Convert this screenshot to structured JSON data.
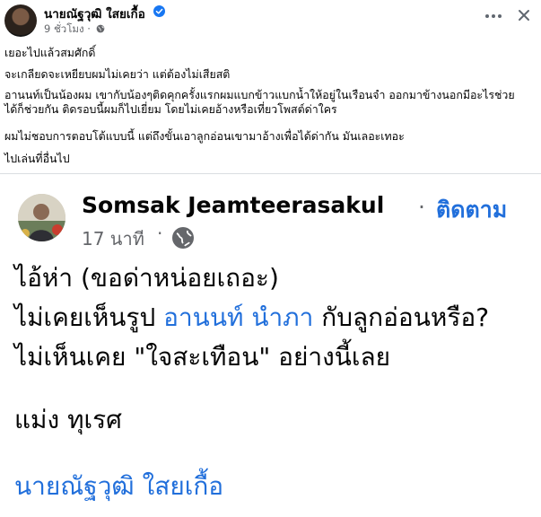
{
  "post": {
    "author": "นายณัฐวุฒิ ใสยเกื้อ",
    "time": "9 ชั่วโมง",
    "meta_sep": "·",
    "paragraphs": [
      "เยอะไปแล้วสมศักดิ์",
      "จะเกลียดจะเหยียบผมไม่เคยว่า แต่ต้องไม่เสียสติ",
      "อานนท์เป็นน้องผม เขากับน้องๆติดคุกครั้งแรกผมแบกข้าวแบกน้ำให้อยู่ในเรือนจำ ออกมาข้างนอกมีอะไรช่วย",
      "ได้ก็ช่วยกัน ติดรอบนี้ผมก็ไปเยี่ยม โดยไม่เคยอ้างหรือเที่ยวโพสต์ด่าใคร",
      "ผมไม่ชอบการตอบโต้แบบนี้ แต่ถึงขั้นเอาลูกอ่อนเขามาอ้างเพื่อได้ด่ากัน มันเลอะเทอะ",
      "ไปเล่นที่อื่นไป"
    ]
  },
  "shared_image": {
    "name": "Somsak Jeamteerasakul",
    "dot": "·",
    "follow": "ติดตาม",
    "time": "17 นาที",
    "time_sep": "·",
    "line1": "ไอ้ห่า (ขอด่าหน่อยเถอะ)",
    "line2_pre": "ไม่เคยเห็นรูป ",
    "line2_link": "อานนท์ นำภา",
    "line2_post": " กับลูกอ่อนหรือ?",
    "line3": "ไม่เห็นเคย \"ใจสะเทือน\" อย่างนี้เลย",
    "line4": "แม่ง ทุเรศ",
    "line5": "นายณัฐวุฒิ  ใสยเกื้อ"
  },
  "colors": {
    "link": "#216fdb",
    "meta": "#65676b",
    "verified": "#1877f2"
  },
  "icons": [
    "verified-badge-icon",
    "globe-icon",
    "more-options-icon",
    "close-icon"
  ]
}
